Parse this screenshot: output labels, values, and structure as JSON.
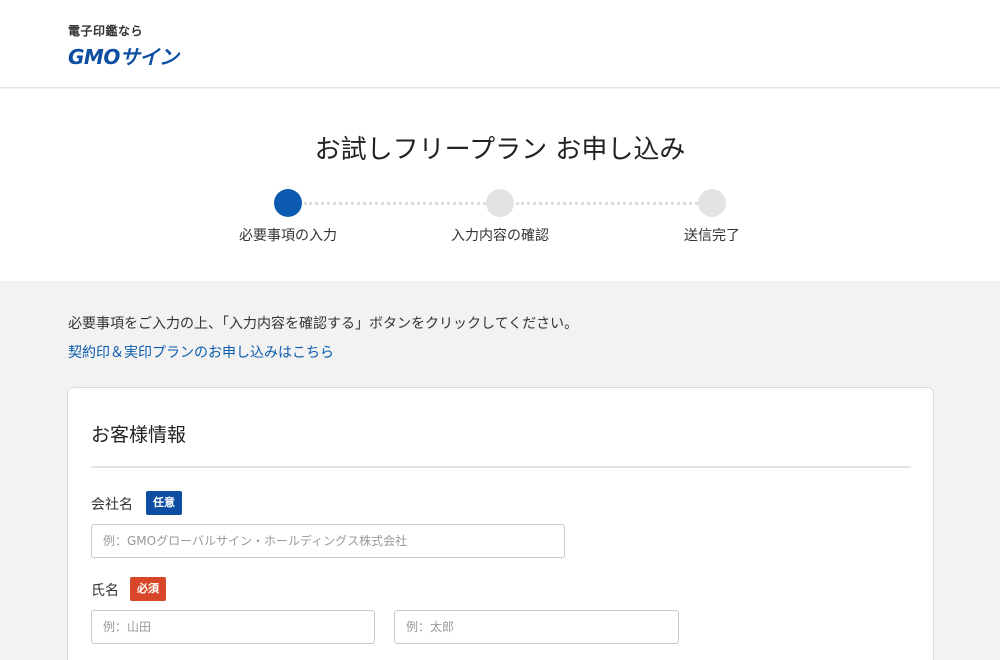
{
  "header": {
    "tagline": "電子印鑑なら",
    "brand": "GMOサイン"
  },
  "page": {
    "title": "お試しフリープラン お申し込み"
  },
  "steps": [
    {
      "label": "必要事項の入力",
      "active": true
    },
    {
      "label": "入力内容の確認",
      "active": false
    },
    {
      "label": "送信完了",
      "active": false
    }
  ],
  "intro": "必要事項をご入力の上、「入力内容を確認する」ボタンをクリックしてください。",
  "plan_link": "契約印＆実印プランのお申し込みはこちら",
  "form": {
    "section_title": "お客様情報",
    "company": {
      "label": "会社名",
      "badge": "任意",
      "placeholder": "例：GMOグローバルサイン・ホールディングス株式会社"
    },
    "name": {
      "label": "氏名",
      "badge": "必須",
      "last_placeholder": "例：山田",
      "first_placeholder": "例：太郎"
    }
  },
  "colors": {
    "brand": "#0d4ea3",
    "link": "#0b5cad",
    "step_active": "#0d5bb0",
    "step_inactive": "#e3e3e3",
    "required_badge": "#d9472b",
    "optional_badge": "#0d4ea3"
  }
}
